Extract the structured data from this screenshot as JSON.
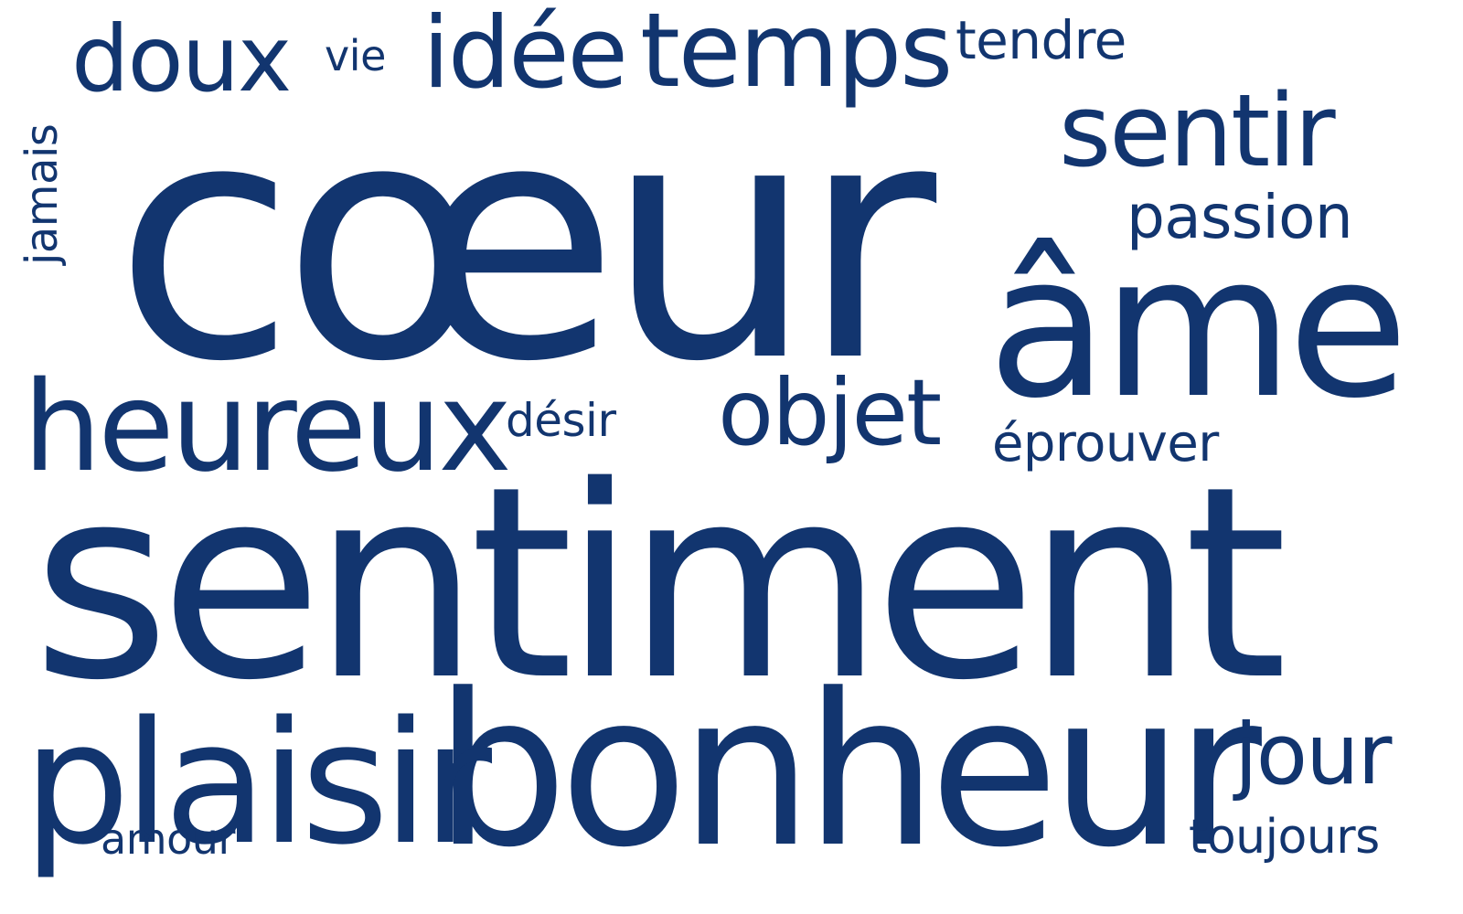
{
  "style": {
    "background": "#ffffff",
    "word_color": "#12356f"
  },
  "words": {
    "coeur": "cœur",
    "sentiment": "sentiment",
    "bonheur": "bonheur",
    "plaisir": "plaisir",
    "ame": "âme",
    "heureux": "heureux",
    "temps": "temps",
    "idee": "idée",
    "sentir": "sentir",
    "objet": "objet",
    "doux": "doux",
    "jour": "jour",
    "passion": "passion",
    "eprouver": "éprouver",
    "tendre": "tendre",
    "toujours": "toujours",
    "amour": "amour",
    "desir": "désir",
    "vie": "vie",
    "jamais": "jamais"
  }
}
